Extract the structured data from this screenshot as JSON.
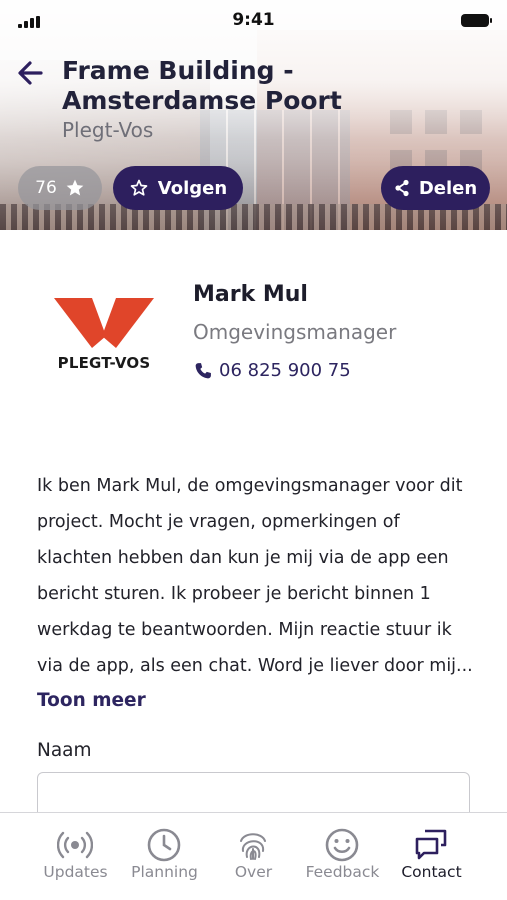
{
  "status_bar": {
    "time": "9:41"
  },
  "header": {
    "title": "Frame Building - Amsterdamse Poort",
    "subtitle": "Plegt-Vos",
    "rating": "76",
    "follow_label": "Volgen",
    "share_label": "Delen"
  },
  "contact": {
    "logo_text": "PLEGT-VOS",
    "name": "Mark Mul",
    "role": "Omgevingsmanager",
    "phone": "06 825 900 75",
    "bio": "Ik ben Mark Mul, de omgevingsmanager voor dit project. Mocht je vragen, opmerkingen of klachten hebben dan kun je mij via de app een bericht sturen. Ik probeer je bericht binnen 1 werkdag te beantwoorden. Mijn reactie stuur ik via de app, als een chat. Word je liever door mij...",
    "more_label": "Toon meer"
  },
  "form": {
    "name_label": "Naam",
    "name_value": ""
  },
  "tabs": [
    {
      "label": "Updates",
      "icon": "broadcast-icon",
      "active": false
    },
    {
      "label": "Planning",
      "icon": "clock-icon",
      "active": false
    },
    {
      "label": "Over",
      "icon": "fingerprint-icon",
      "active": false
    },
    {
      "label": "Feedback",
      "icon": "smiley-icon",
      "active": false
    },
    {
      "label": "Contact",
      "icon": "chat-icon",
      "active": true
    }
  ],
  "colors": {
    "brand_dark": "#2d1f5e",
    "link": "#2d2560",
    "logo_red": "#e0452a"
  }
}
